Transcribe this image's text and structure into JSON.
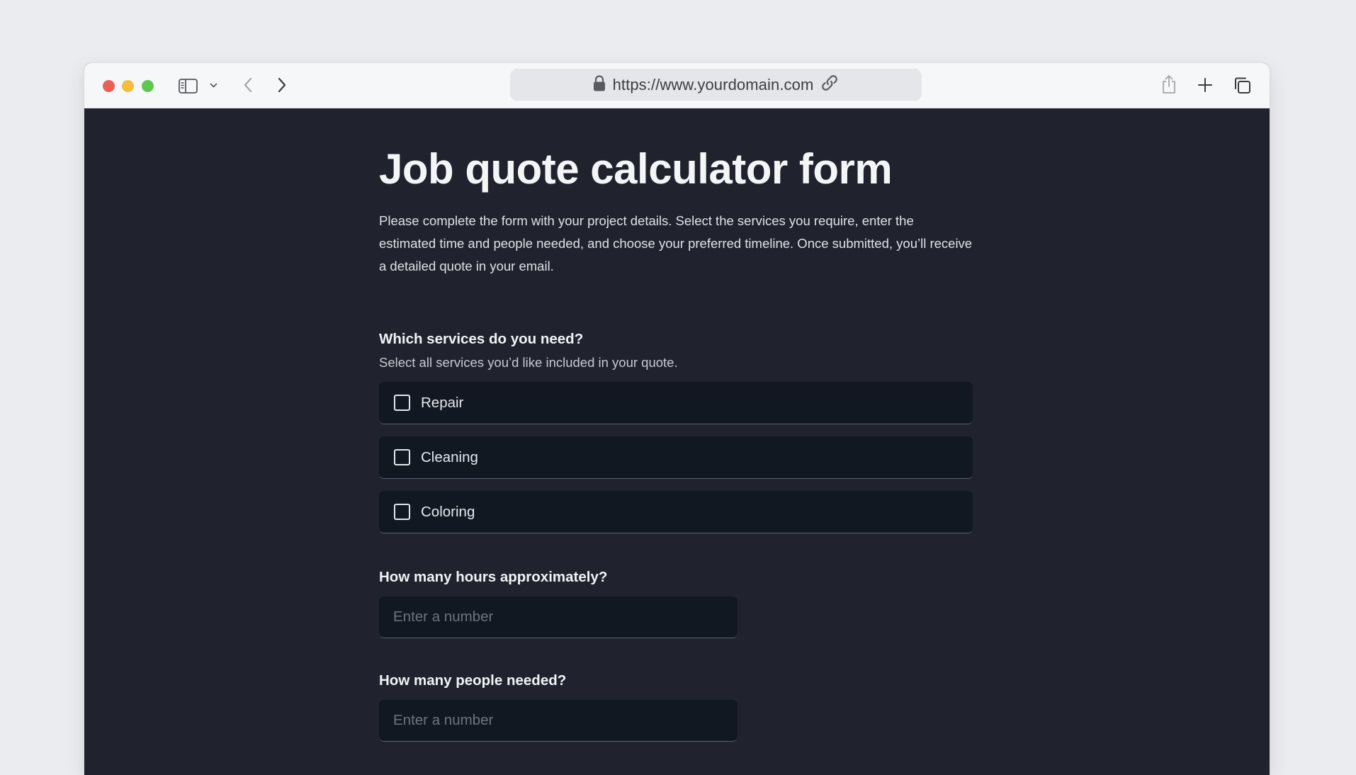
{
  "browser": {
    "url": "https://www.yourdomain.com"
  },
  "icons": {
    "close": "red-close-dot",
    "minimize": "yellow-minimize-dot",
    "zoom": "green-zoom-dot",
    "sidebar": "sidebar-icon",
    "sidebar_menu": "chevron-down-icon",
    "back": "chevron-left-icon",
    "forward": "chevron-right-icon",
    "secure": "lock-icon",
    "copy_link": "link-icon",
    "share": "share-icon",
    "new_tab": "plus-icon",
    "tab_overview": "tabs-icon"
  },
  "colors": {
    "page_bg": "#20232d",
    "field_bg": "#111822",
    "toolbar_bg": "#f6f7f9"
  },
  "form": {
    "title": "Job quote calculator form",
    "intro": "Please complete the form with your project details. Select the services you require, enter the estimated time and people needed, and choose your preferred timeline. Once submitted, you’ll receive a detailed quote in your email.",
    "services": {
      "label": "Which services do you need?",
      "hint": "Select all services you’d like included in your quote.",
      "options": [
        {
          "label": "Repair",
          "checked": false
        },
        {
          "label": "Cleaning",
          "checked": false
        },
        {
          "label": "Coloring",
          "checked": false
        }
      ]
    },
    "hours": {
      "label": "How many hours approximately?",
      "placeholder": "Enter a number",
      "value": ""
    },
    "people": {
      "label": "How many people needed?",
      "placeholder": "Enter a number",
      "value": ""
    }
  }
}
